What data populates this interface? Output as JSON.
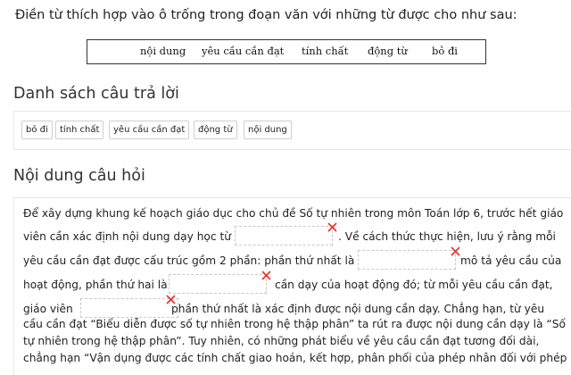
{
  "instruction": "Điền từ thích hợp vào ô trống trong đoạn văn với những từ được cho như sau:",
  "word_bank": [
    "nội dung",
    "yêu cầu cần đạt",
    "tính chất",
    "động từ",
    "bỏ đi"
  ],
  "answers_title": "Danh sách câu trả lời",
  "answer_chips": [
    "bỏ đi",
    "tính chất",
    "yêu cầu cần đạt",
    "động từ",
    "nội dung"
  ],
  "content_title": "Nội dung câu hỏi",
  "question_lines": {
    "l1": "Để xây dựng khung kế hoạch giáo dục cho chủ đề Số tự nhiên trong môn Toán lớp 6, trước hết giáo",
    "l2a": "viên cần xác định nội dung dạy học từ",
    "l2b": ". Về cách thức thực hiện, lưu ý rằng mỗi",
    "l3a": "yêu cầu cần đạt được cấu trúc gồm 2 phần: phần thứ nhất là",
    "l3b": "mô tả yêu cầu của",
    "l4a": "hoạt động, phần thứ hai là",
    "l4b": "cần dạy của hoạt động đó; từ mỗi yêu cầu cần đạt,",
    "l5a": "giáo viên",
    "l5b": "phần thứ nhất là xác định được nội dung cần dạy. Chẳng hạn, từ yêu",
    "l6": "cầu cần đạt “Biểu diễn được số tự nhiên trong hệ thập phân” ta rút ra được nội dung cần dạy là “Số",
    "l7": "tự nhiên trong hệ thập phân”. Tuy nhiên, có những phát biểu về yêu cầu cần đạt tương đối dài,",
    "l8": "chẳng hạn “Vận dụng được các tính chất giao hoán, kết hợp, phân phối của phép nhân đối với phép"
  },
  "colors": {
    "error_mark": "#e53935",
    "text": "#222222",
    "border": "#e6e6e6"
  },
  "icons": {
    "wrong": "x-mark-icon"
  }
}
